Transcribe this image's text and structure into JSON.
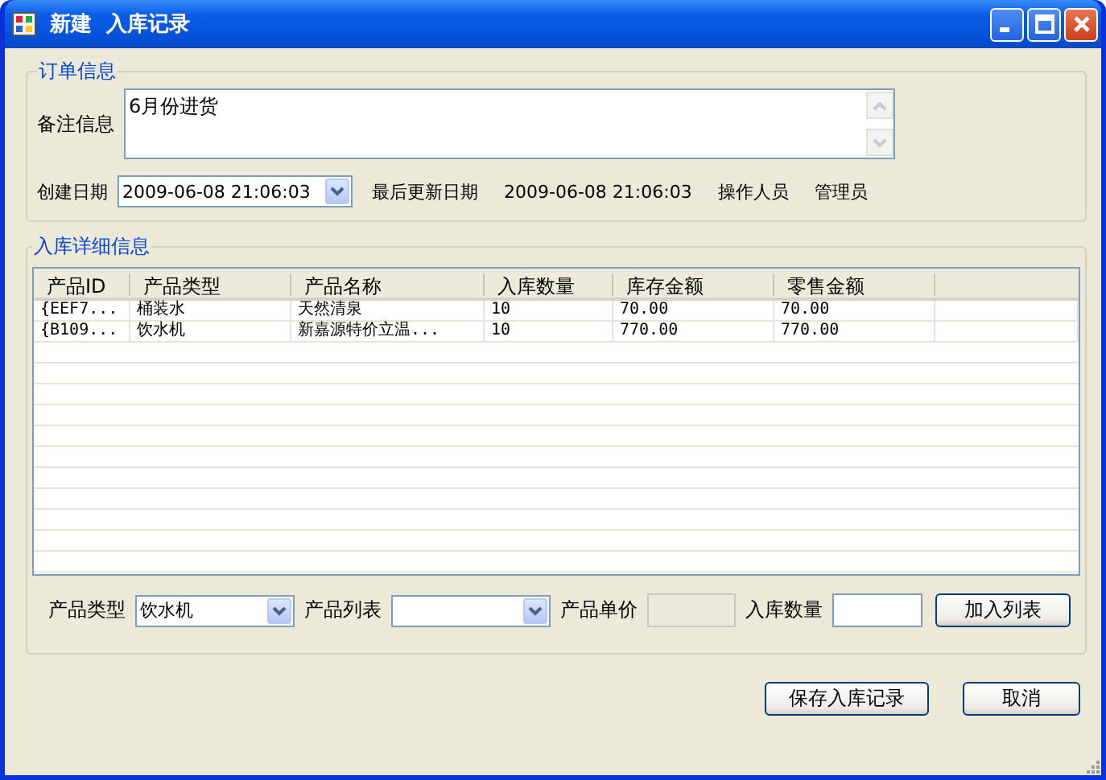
{
  "window": {
    "title": "新建  入库记录"
  },
  "order_group": {
    "title": "订单信息",
    "remark": {
      "label": "备注信息",
      "value": "6月份进货"
    },
    "created": {
      "label": "创建日期",
      "value": "2009-06-08 21:06:03"
    },
    "updated": {
      "label": "最后更新日期",
      "value": "2009-06-08 21:06:03"
    },
    "operator": {
      "label": "操作人员",
      "value": "管理员"
    }
  },
  "detail_group": {
    "title": "入库详细信息",
    "table": {
      "columns": [
        "产品ID",
        "产品类型",
        "产品名称",
        "入库数量",
        "库存金额",
        "零售金额"
      ],
      "rows": [
        [
          "{EEF7...",
          "桶装水",
          "天然清泉",
          "10",
          "70.00",
          "70.00"
        ],
        [
          "{B109...",
          "饮水机",
          "新嘉源特价立温...",
          "10",
          "770.00",
          "770.00"
        ]
      ]
    },
    "product_type": {
      "label": "产品类型",
      "value": "饮水机"
    },
    "product_list": {
      "label": "产品列表"
    },
    "unit_price": {
      "label": "产品单价",
      "disabled": true
    },
    "quantity": {
      "label": "入库数量"
    },
    "add_button": "加入列表"
  },
  "buttons": [
    "保存入库记录",
    "取消"
  ]
}
